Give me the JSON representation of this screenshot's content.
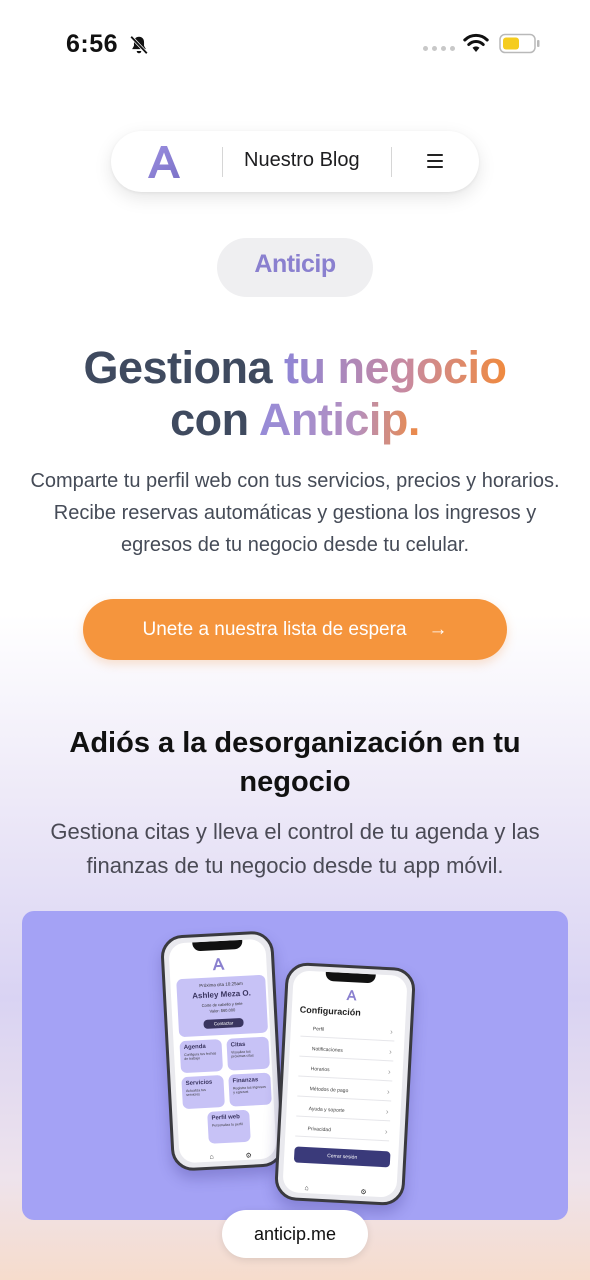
{
  "status_bar": {
    "time": "6:56"
  },
  "nav": {
    "blog_label": "Nuestro Blog"
  },
  "brand": {
    "name": "Anticip"
  },
  "hero": {
    "title_part1": "Gestiona",
    "title_part2": "tu negocio",
    "title_part3": "con",
    "title_part4": "Anticip.",
    "subtitle": "Comparte tu perfil web con tus servicios, precios y horarios. Recibe reservas automáticas y gestiona los ingresos y egresos de tu negocio desde tu celular.",
    "cta_label": "Unete a nuestra lista de espera",
    "cta_arrow": "→"
  },
  "section": {
    "title": "Adiós a la desorganización en tu negocio",
    "subtitle": "Gestiona citas y lleva el control de tu agenda y las finanzas de tu negocio desde tu app móvil."
  },
  "mockup": {
    "phone1": {
      "next_label": "Próxima cita 10:25am",
      "client_name": "Ashley Meza O.",
      "client_detail": "Corte de cabello y tinte",
      "client_value": "Valor: $60.000",
      "contact_label": "Contactar",
      "tiles": [
        {
          "title": "Agenda",
          "desc": "Configura tus fechas de trabajo"
        },
        {
          "title": "Citas",
          "desc": "Visualiza tus próximas citas"
        },
        {
          "title": "Servicios",
          "desc": "Actualiza tus servicios"
        },
        {
          "title": "Finanzas",
          "desc": "Registra tus ingresos y egresos"
        },
        {
          "title": "Perfil web",
          "desc": "Personaliza tu perfil"
        }
      ]
    },
    "phone2": {
      "title": "Configuración",
      "items": [
        "Perfil",
        "Notificaciones",
        "Horarios",
        "Métodos de pago",
        "Ayuda y soporte",
        "Privacidad"
      ],
      "logout_label": "Cerrar sesión"
    }
  },
  "url_bar": {
    "url": "anticip.me"
  },
  "colors": {
    "accent_orange": "#f5953d",
    "brand_purple": "#8f86d6",
    "heading_dark": "#3f4a5f",
    "showcase_bg": "#a4a2f5"
  }
}
